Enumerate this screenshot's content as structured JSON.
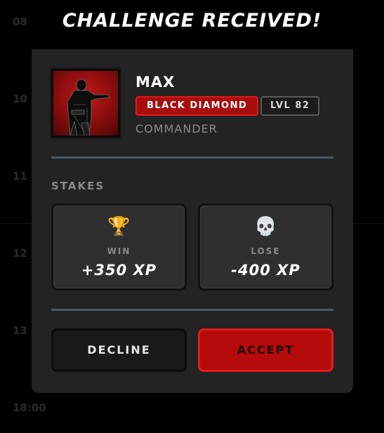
{
  "background": {
    "numbers": [
      "08",
      "10",
      "11",
      "12",
      "13",
      "18:00"
    ]
  },
  "header": {
    "title": "CHALLENGE RECEIVED!"
  },
  "player": {
    "name": "MAX",
    "rank": "BLACK DIAMOND",
    "level": "LVL 82",
    "title": "COMMANDER",
    "avatar_icon": "soldier-portrait"
  },
  "stakes": {
    "label": "STAKES",
    "win": {
      "icon": "trophy-icon",
      "glyph": "🏆",
      "label": "WIN",
      "value": "+350 XP"
    },
    "lose": {
      "icon": "skull-icon",
      "glyph": "💀",
      "label": "LOSE",
      "value": "-400 XP"
    }
  },
  "actions": {
    "decline_label": "DECLINE",
    "accept_label": "ACCEPT"
  },
  "colors": {
    "accent": "#b50b0b",
    "card": "#232323",
    "divider": "#4c5a66"
  }
}
